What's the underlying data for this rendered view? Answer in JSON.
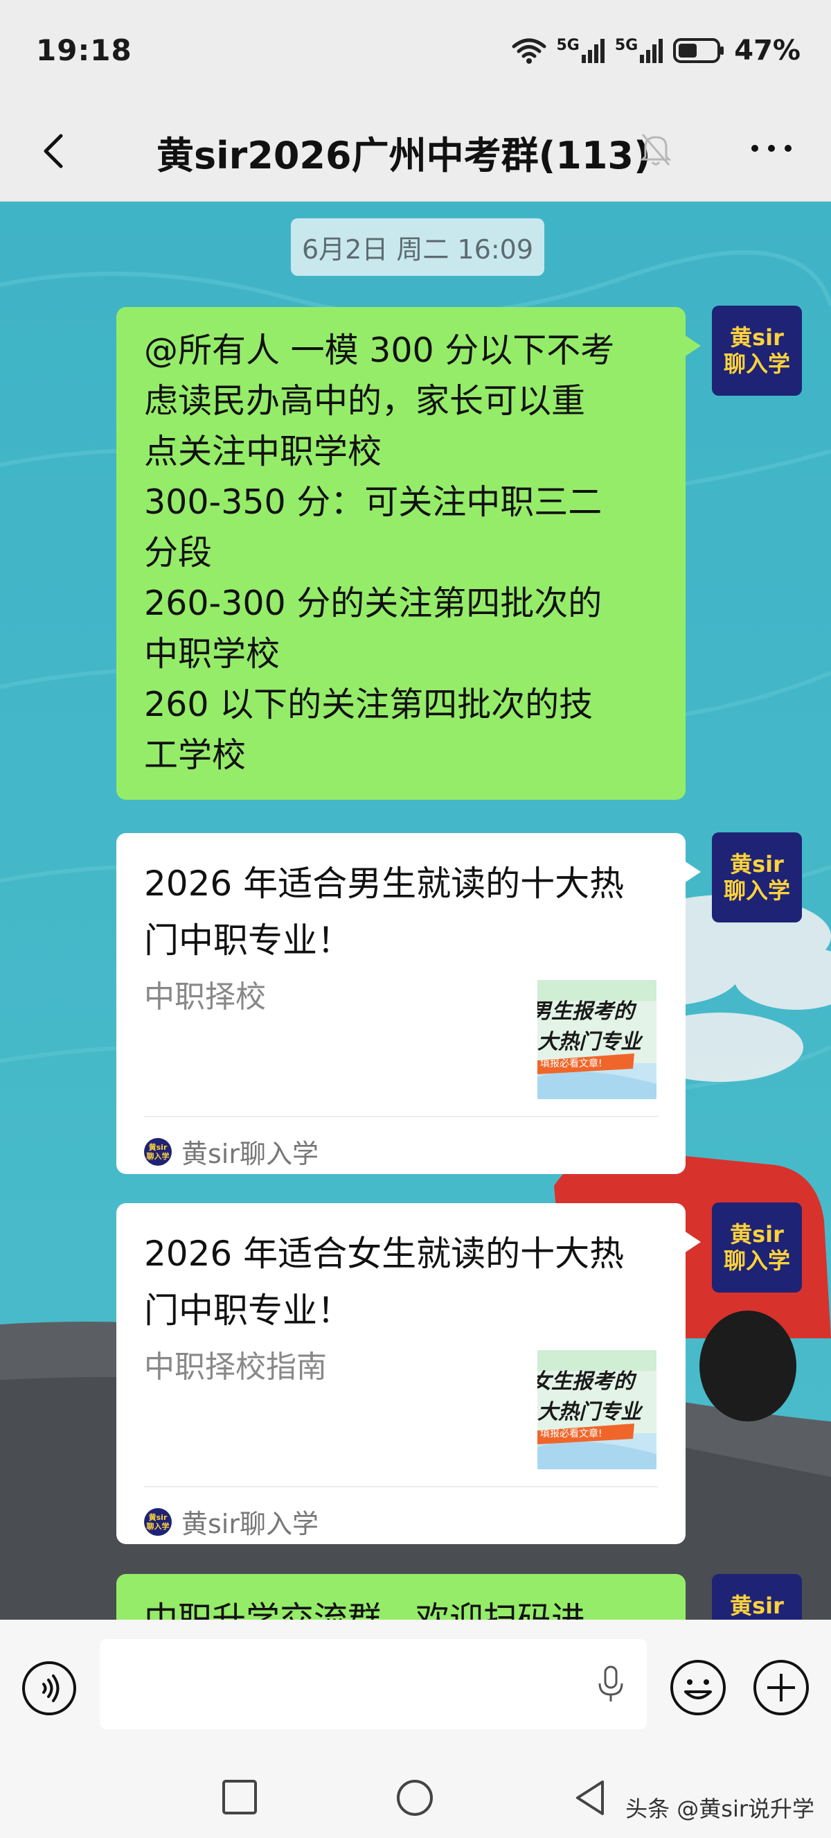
{
  "status_bar": {
    "time": "19:18",
    "signal1": "5G",
    "signal2": "5G",
    "battery": "47%"
  },
  "nav": {
    "title": "黄sir2026广州中考群(113)",
    "back_icon": "chevron-left-icon",
    "mute_icon": "bell-off-icon",
    "more_icon": "more-dots-icon"
  },
  "chat": {
    "timestamp": "6月2日 周二 16:09",
    "avatar_text": [
      "黄sir",
      "聊入学"
    ],
    "message1": {
      "lines": [
        "@所有人  一模 300 分以下不考",
        "虑读民办高中的，家长可以重",
        "点关注中职学校",
        "300-350 分：可关注中职三二",
        "分段",
        "260-300 分的关注第四批次的",
        "中职学校",
        "260 以下的关注第四批次的技",
        "工学校"
      ]
    },
    "card1": {
      "title": "2026 年适合男生就读的十大热门中职专业！",
      "desc": "中职择校",
      "thumb_line1": "男生报考的",
      "thumb_line2": "大热门专业",
      "thumb_tag": "填报必看文章!",
      "source_logo": [
        "黄sir",
        "聊入学"
      ],
      "source": "黄sir聊入学"
    },
    "card2": {
      "title": "2026 年适合女生就读的十大热门中职专业！",
      "desc": "中职择校指南",
      "thumb_line1": "女生报考的",
      "thumb_line2": "大热门专业",
      "thumb_tag": "填报必看文章!",
      "source_logo": [
        "黄sir",
        "聊入学"
      ],
      "source": "黄sir聊入学"
    },
    "message_partial": "中职升学交流群，欢迎扫码进"
  },
  "input_bar": {
    "voice_icon": "voice-icon",
    "mic_icon": "microphone-icon",
    "emoji_icon": "smiley-icon",
    "plus_icon": "plus-circle-icon"
  },
  "system_nav": {
    "watermark": "头条 @黄sir说升学"
  },
  "colors": {
    "chat_bg": "#43b7c8",
    "bubble_green": "#95ec69",
    "avatar_bg": "#1e2375",
    "avatar_text": "#ffd23c"
  }
}
